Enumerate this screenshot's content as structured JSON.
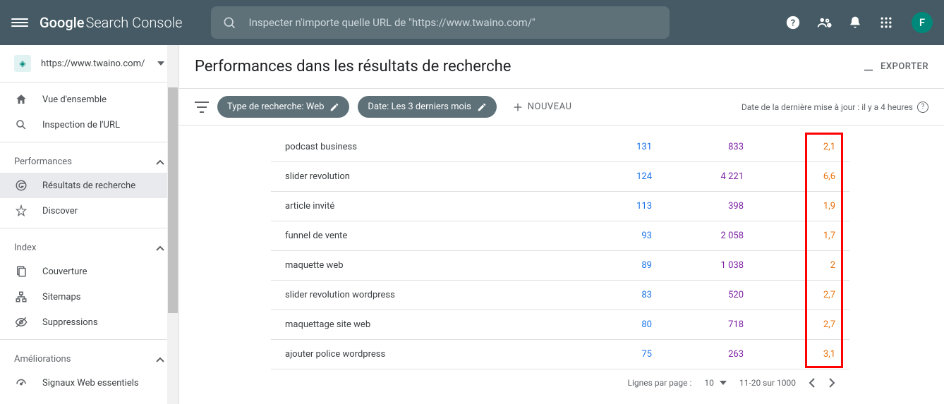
{
  "header": {
    "logo_google": "Google",
    "logo_rest": "Search Console",
    "search_placeholder": "Inspecter n'importe quelle URL de \"https://www.twaino.com/\"",
    "avatar_initial": "F"
  },
  "sidebar": {
    "property": {
      "url": "https://www.twaino.com/"
    },
    "top_items": [
      {
        "label": "Vue d'ensemble"
      },
      {
        "label": "Inspection de l'URL"
      }
    ],
    "sections": [
      {
        "header": "Performances",
        "items": [
          {
            "label": "Résultats de recherche",
            "active": true
          },
          {
            "label": "Discover",
            "active": false
          }
        ]
      },
      {
        "header": "Index",
        "items": [
          {
            "label": "Couverture"
          },
          {
            "label": "Sitemaps"
          },
          {
            "label": "Suppressions"
          }
        ]
      },
      {
        "header": "Améliorations",
        "items": [
          {
            "label": "Signaux Web essentiels"
          }
        ]
      }
    ]
  },
  "page": {
    "title": "Performances dans les résultats de recherche",
    "export_label": "EXPORTER"
  },
  "filters": {
    "type_chip": "Type de recherche: Web",
    "date_chip": "Date: Les 3 derniers mois",
    "new_label": "NOUVEAU",
    "update_text": "Date de la dernière mise à jour : il y a 4 heures"
  },
  "table": {
    "rows": [
      {
        "query": "podcast business",
        "clicks": "131",
        "impressions": "833",
        "position": "2,1"
      },
      {
        "query": "slider revolution",
        "clicks": "124",
        "impressions": "4 221",
        "position": "6,6"
      },
      {
        "query": "article invité",
        "clicks": "113",
        "impressions": "398",
        "position": "1,9"
      },
      {
        "query": "funnel de vente",
        "clicks": "93",
        "impressions": "2 058",
        "position": "1,7"
      },
      {
        "query": "maquette web",
        "clicks": "89",
        "impressions": "1 038",
        "position": "2"
      },
      {
        "query": "slider revolution wordpress",
        "clicks": "83",
        "impressions": "520",
        "position": "2,7"
      },
      {
        "query": "maquettage site web",
        "clicks": "80",
        "impressions": "718",
        "position": "2,7"
      },
      {
        "query": "ajouter police wordpress",
        "clicks": "75",
        "impressions": "263",
        "position": "3,1"
      }
    ]
  },
  "pagination": {
    "rows_per_page_label": "Lignes par page :",
    "rows_per_page_value": "10",
    "range": "11-20 sur 1000"
  }
}
